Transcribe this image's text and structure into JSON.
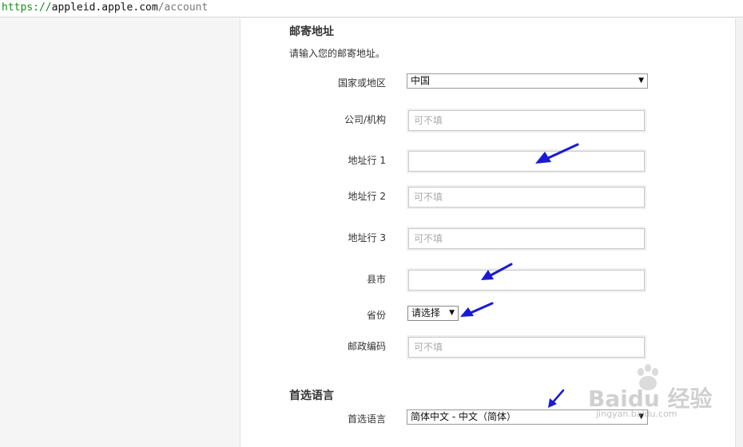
{
  "browser": {
    "url_scheme": "https://",
    "url_host": "appleid.apple.com",
    "url_path": "/account"
  },
  "mailing_address": {
    "title": "邮寄地址",
    "description": "请输入您的邮寄地址。",
    "country_label": "国家或地区",
    "country_value": "中国",
    "company_label": "公司/机构",
    "company_placeholder": "可不填",
    "address1_label": "地址行 1",
    "address1_value": "",
    "address2_label": "地址行 2",
    "address2_placeholder": "可不填",
    "address3_label": "地址行 3",
    "address3_placeholder": "可不填",
    "city_label": "县市",
    "city_value": "",
    "province_label": "省份",
    "province_value": "请选择",
    "postal_label": "邮政编码",
    "postal_placeholder": "可不填"
  },
  "language": {
    "title": "首选语言",
    "label": "首选语言",
    "value": "简体中文 - 中文（简体）"
  },
  "watermark": {
    "brand": "Baidu 经验",
    "url": "jingyan.baidu.com"
  },
  "colors": {
    "annotation_arrow": "#1a1ad6",
    "url_scheme": "#1b8a1b"
  }
}
